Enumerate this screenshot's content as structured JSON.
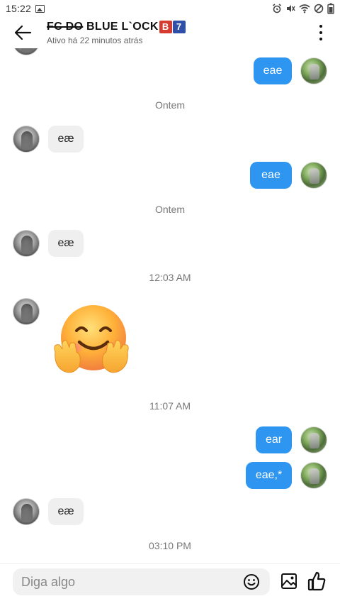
{
  "status_bar": {
    "time": "15:22"
  },
  "header": {
    "title": "FC DO BLUE L`OCK",
    "title_struck": "FC DO",
    "title_rest": " BLUE L`OCK",
    "badge_b": "B",
    "badge_7": "7",
    "subtitle": "Ativo há 22 minutos atrás"
  },
  "messages": [
    {
      "type": "outgoing",
      "text": "eae"
    },
    {
      "type": "separator",
      "text": "Ontem"
    },
    {
      "type": "incoming",
      "text": "eæ"
    },
    {
      "type": "outgoing",
      "text": "eae"
    },
    {
      "type": "separator",
      "text": "Ontem"
    },
    {
      "type": "incoming",
      "text": "eæ"
    },
    {
      "type": "separator",
      "text": "12:03 AM"
    },
    {
      "type": "incoming-emoji",
      "text": "hugging-face-emoji"
    },
    {
      "type": "separator",
      "text": "11:07 AM"
    },
    {
      "type": "outgoing",
      "text": "ear"
    },
    {
      "type": "outgoing",
      "text": "eae,*"
    },
    {
      "type": "incoming",
      "text": "eæ"
    },
    {
      "type": "separator",
      "text": "03:10 PM"
    }
  ],
  "composer": {
    "placeholder": "Diga algo"
  },
  "colors": {
    "outgoing_bubble": "#2e95f0",
    "incoming_bubble": "#efefef",
    "badge_red": "#d63b2f",
    "badge_blue": "#2f4fa8"
  },
  "icons": [
    "back-arrow-icon",
    "more-vertical-icon",
    "emoji-icon",
    "image-icon",
    "like-icon",
    "alarm-icon",
    "mute-icon",
    "wifi-icon",
    "block-icon",
    "battery-icon",
    "gallery-notification-icon"
  ]
}
